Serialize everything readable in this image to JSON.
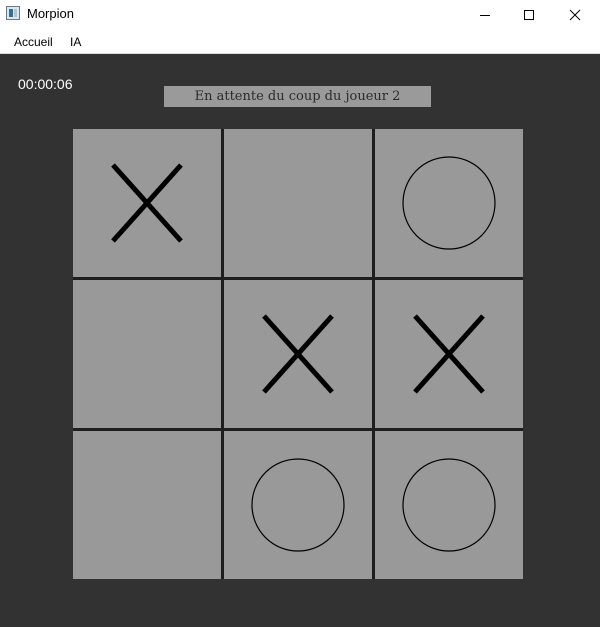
{
  "window": {
    "title": "Morpion",
    "icons": {
      "app": "app-window-icon",
      "minimize": "minimize-icon",
      "maximize": "maximize-icon",
      "close": "close-icon"
    }
  },
  "menu": {
    "items": [
      {
        "label": "Accueil"
      },
      {
        "label": "IA"
      }
    ]
  },
  "game": {
    "timer": "00:00:06",
    "status": "En attente du coup du joueur 2",
    "board": [
      [
        "X",
        "",
        "O"
      ],
      [
        "",
        "X",
        "X"
      ],
      [
        "",
        "O",
        "O"
      ]
    ]
  },
  "colors": {
    "background": "#323232",
    "cell": "#999999",
    "grid_line": "#1e1e1e",
    "status_bar": "#9a9a9a",
    "mark": "#000000"
  }
}
